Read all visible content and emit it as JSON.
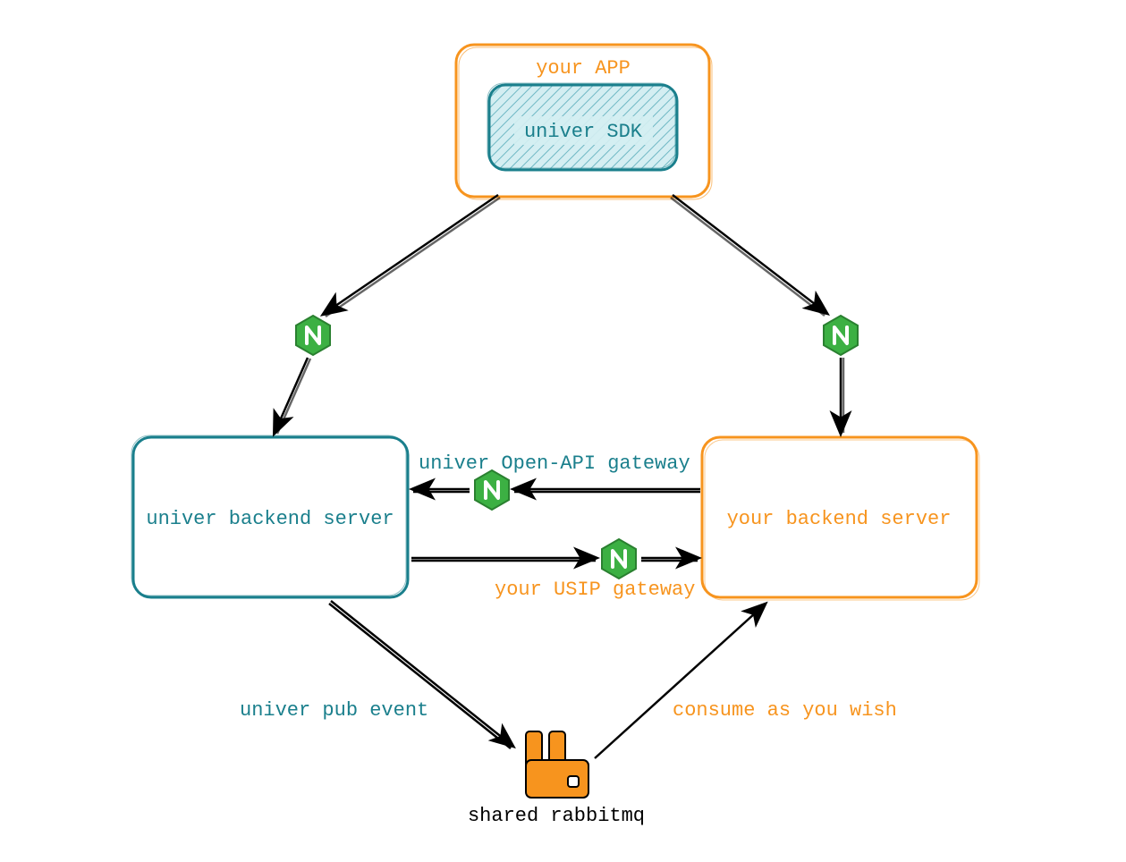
{
  "nodes": {
    "app": {
      "label": "your APP",
      "child": {
        "label": "univer SDK"
      }
    },
    "univer_backend": {
      "label": "univer backend server"
    },
    "your_backend": {
      "label": "your backend server"
    },
    "rabbitmq": {
      "label": "shared rabbitmq"
    }
  },
  "edges": {
    "open_api_gateway": "univer Open-API gateway",
    "usip_gateway": "your USIP gateway",
    "pub_event": "univer pub event",
    "consume": "consume as you wish"
  },
  "colors": {
    "teal": "#1a7f8c",
    "orange": "#f7941e",
    "green": "#3cb043"
  }
}
